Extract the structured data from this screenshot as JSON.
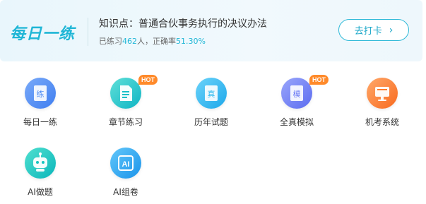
{
  "banner": {
    "brand": "每日一练",
    "knowledge_title": "知识点：普通合伙事务执行的决议办法",
    "stats_prefix": "已练习",
    "practiced_count": "462",
    "stats_mid": "人，正确率",
    "accuracy": "51.30%",
    "checkin_label": "去打卡"
  },
  "features": [
    {
      "label": "每日一练",
      "icon": "daily-practice-icon",
      "glyph": "练",
      "badge": "",
      "color": "#4d8cf5"
    },
    {
      "label": "章节练习",
      "icon": "chapter-practice-icon",
      "glyph": "",
      "badge": "HOT",
      "color": "#17c0c7"
    },
    {
      "label": "历年试题",
      "icon": "past-exams-icon",
      "glyph": "真",
      "badge": "",
      "color": "#24b6ee"
    },
    {
      "label": "全真模拟",
      "icon": "mock-exam-icon",
      "glyph": "模",
      "badge": "HOT",
      "color": "#6f7ef5"
    },
    {
      "label": "机考系统",
      "icon": "computer-exam-icon",
      "glyph": "",
      "badge": "",
      "color": "#fd7b2c"
    },
    {
      "label": "AI做题",
      "icon": "ai-robot-icon",
      "glyph": "",
      "badge": "",
      "color": "#16c4c0"
    },
    {
      "label": "AI组卷",
      "icon": "ai-paper-icon",
      "glyph": "AI",
      "badge": "",
      "color": "#29a8f0"
    }
  ]
}
